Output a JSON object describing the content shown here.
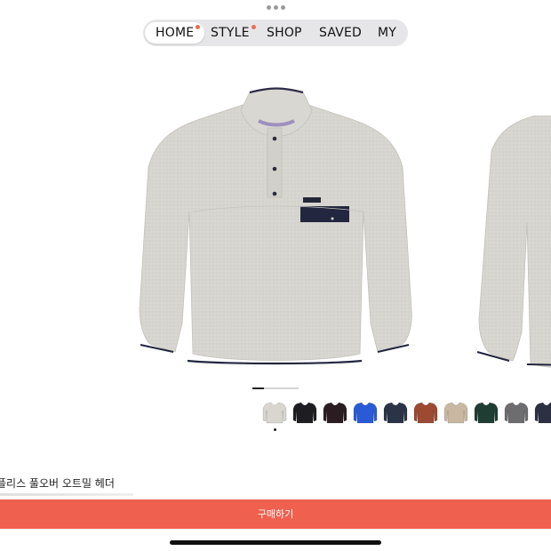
{
  "nav": {
    "items": [
      {
        "label": "HOME",
        "active": true,
        "badge": true
      },
      {
        "label": "STYLE",
        "active": false,
        "badge": true
      },
      {
        "label": "SHOP",
        "active": false,
        "badge": false
      },
      {
        "label": "SAVED",
        "active": false,
        "badge": false
      },
      {
        "label": "MY",
        "active": false,
        "badge": false
      }
    ]
  },
  "product": {
    "image_icon": "fleece-pullover-image",
    "name": "플리스 풀오버 오트밀 헤더",
    "swatch_colors": [
      "#d8d6cf",
      "#1e1e22",
      "#2a1d22",
      "#2a5bd6",
      "#2b3447",
      "#9c4a32",
      "#c9b7a1",
      "#1f3d33",
      "#6d6d70",
      "#2c3042"
    ],
    "selected_swatch": 0,
    "image_page": 1,
    "image_pages_total": 4
  },
  "cta": {
    "buy_label": "구매하기"
  },
  "colors": {
    "accent": "#f0604f",
    "badge": "#ef6b57"
  }
}
